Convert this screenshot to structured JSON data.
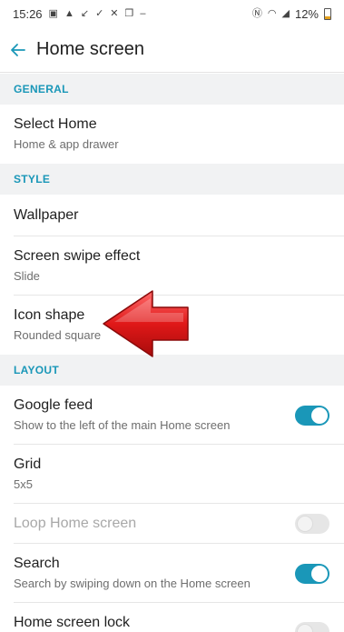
{
  "status_bar": {
    "time": "15:26",
    "battery": "12%"
  },
  "header": {
    "title": "Home screen"
  },
  "sections": {
    "general": "GENERAL",
    "style": "STYLE",
    "layout": "LAYOUT"
  },
  "rows": {
    "select_home": {
      "title": "Select Home",
      "subtitle": "Home & app drawer"
    },
    "wallpaper": {
      "title": "Wallpaper"
    },
    "swipe_effect": {
      "title": "Screen swipe effect",
      "subtitle": "Slide"
    },
    "icon_shape": {
      "title": "Icon shape",
      "subtitle": "Rounded square"
    },
    "google_feed": {
      "title": "Google feed",
      "subtitle": "Show to the left of the main Home screen",
      "enabled": true
    },
    "grid": {
      "title": "Grid",
      "subtitle": "5x5"
    },
    "loop": {
      "title": "Loop Home screen",
      "enabled": false
    },
    "search": {
      "title": "Search",
      "subtitle": "Search by swiping down on the Home screen",
      "enabled": true
    },
    "lock": {
      "title": "Home screen lock",
      "enabled": false
    }
  },
  "colors": {
    "accent": "#1a97b8",
    "arrow": "#d81e1e"
  }
}
